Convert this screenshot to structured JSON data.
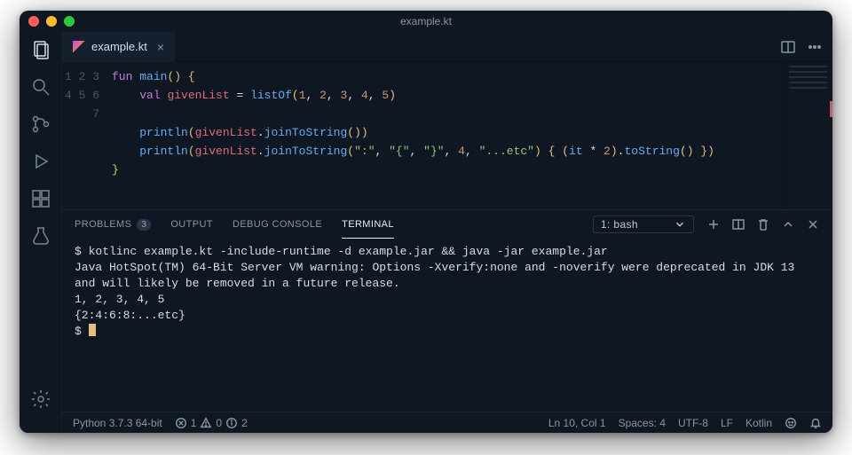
{
  "window": {
    "title": "example.kt"
  },
  "tabs": {
    "file": "example.kt"
  },
  "icons": {
    "explorer": "explorer",
    "search": "search",
    "scm": "source-control",
    "run": "run-debug",
    "extensions": "extensions",
    "testing": "testing",
    "settings": "settings"
  },
  "code": {
    "lines": [
      "1",
      "2",
      "3",
      "4",
      "5",
      "6",
      "7"
    ],
    "l1": {
      "kw_fun": "fun",
      "fn": "main",
      "paren_o": "(",
      "paren_c": ")",
      "brace_o": " {"
    },
    "l2": {
      "kw_val": "val",
      "var": "givenList",
      "eq": " = ",
      "fn": "listOf",
      "args_open": "(",
      "n1": "1",
      "c": ", ",
      "n2": "2",
      "n3": "3",
      "n4": "4",
      "n5": "5",
      "args_close": ")"
    },
    "l4": {
      "fn": "println",
      "open": "(",
      "obj": "givenList",
      "dot": ".",
      "m": "joinToString",
      "p": "()",
      "close": ")"
    },
    "l5": {
      "fn": "println",
      "open": "(",
      "obj": "givenList",
      "dot": ".",
      "m": "joinToString",
      "s1": "\":\"",
      "s2": "\"{\"",
      "s3": "\"}\"",
      "n": "4",
      "s4": "\"...etc\"",
      "lam_open": " { ",
      "paren_o": "(",
      "id": "it",
      "op": " * ",
      "n2": "2",
      "paren_c": ")",
      "dot2": ".",
      "m2": "toString",
      "p2": "()",
      "lam_close": " }",
      "close": ")"
    },
    "l6": {
      "brace_c": "}"
    }
  },
  "panel": {
    "problems": {
      "label": "PROBLEMS",
      "count": "3"
    },
    "output": "OUTPUT",
    "debug": "DEBUG CONSOLE",
    "terminal": "TERMINAL",
    "shell": "1: bash"
  },
  "terminal": {
    "l1": "$ kotlinc example.kt -include-runtime -d example.jar && java -jar example.jar",
    "l2": "Java HotSpot(TM) 64-Bit Server VM warning: Options -Xverify:none and -noverify were deprecated in JDK 13 and will likely be removed in a future release.",
    "l3": "1, 2, 3, 4, 5",
    "l4": "{2:4:6:8:...etc}",
    "l5": "$ "
  },
  "status": {
    "python": "Python 3.7.3 64-bit",
    "err": "1",
    "warn": "0",
    "info": "2",
    "lncol": "Ln 10, Col 1",
    "spaces": "Spaces: 4",
    "encoding": "UTF-8",
    "eol": "LF",
    "lang": "Kotlin"
  }
}
